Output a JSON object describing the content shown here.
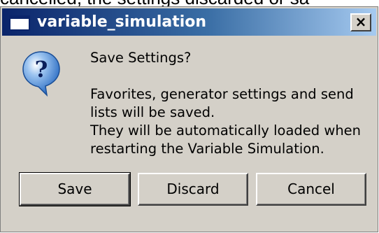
{
  "background_text": "cancelled, the settings discarded or sa",
  "dialog": {
    "title": "variable_simulation",
    "close_glyph": "×",
    "icon": "question-icon",
    "message": {
      "heading": "Save Settings?",
      "lines": [
        "Favorites, generator settings and send",
        "lists will be saved.",
        "They will be automatically loaded when",
        "restarting the Variable Simulation."
      ]
    },
    "buttons": {
      "save": "Save",
      "discard": "Discard",
      "cancel": "Cancel"
    }
  },
  "colors": {
    "title_bar_start": "#0a246a",
    "title_bar_end": "#a6caf0",
    "dialog_face": "#d4d0c8",
    "icon_bubble": "#4a8fd8"
  }
}
